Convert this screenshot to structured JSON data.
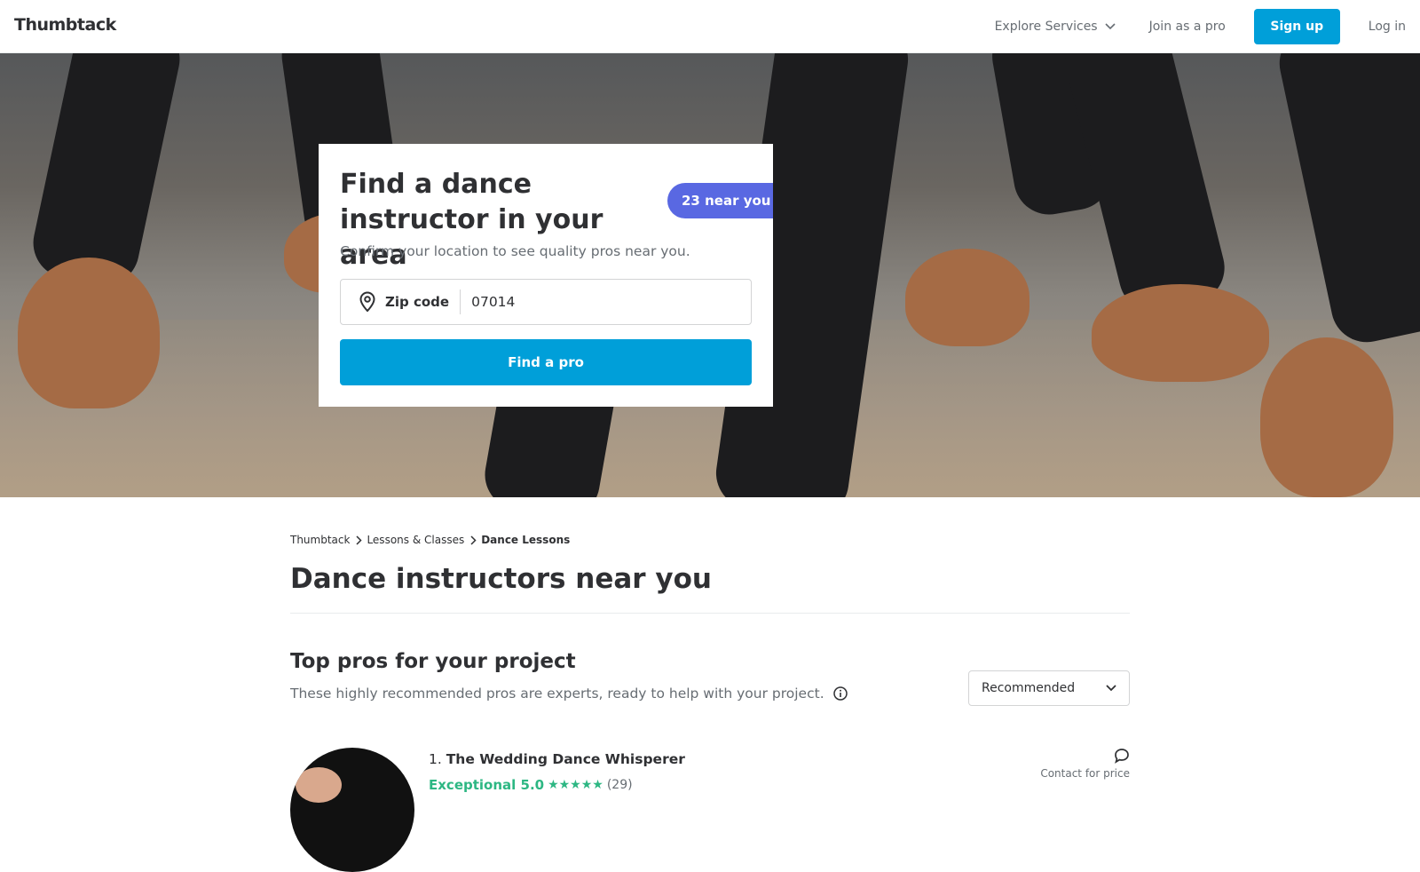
{
  "header": {
    "logo": "Thumbtack",
    "explore": "Explore Services",
    "join": "Join as a pro",
    "signup": "Sign up",
    "login": "Log in"
  },
  "hero": {
    "title": "Find a dance instructor in your area",
    "badge": "23 near you",
    "subtitle": "Confirm your location to see quality pros near you.",
    "zip_label": "Zip code",
    "zip_value": "07014",
    "find_button": "Find a pro"
  },
  "breadcrumb": [
    "Thumbtack",
    "Lessons & Classes",
    "Dance Lessons"
  ],
  "main": {
    "title": "Dance instructors near you",
    "section_title": "Top pros for your project",
    "section_subtitle": "These highly recommended pros are experts, ready to help with your project.",
    "sort_value": "Recommended"
  },
  "pros": [
    {
      "rank": "1.",
      "name": "The Wedding Dance Whisperer",
      "rating_label": "Exceptional 5.0",
      "stars": "★★★★★",
      "review_count": "(29)",
      "contact": "Contact for price"
    }
  ],
  "colors": {
    "brand_blue": "#009fd9",
    "badge_purple": "#5968e2",
    "rating_green": "#2db783"
  }
}
